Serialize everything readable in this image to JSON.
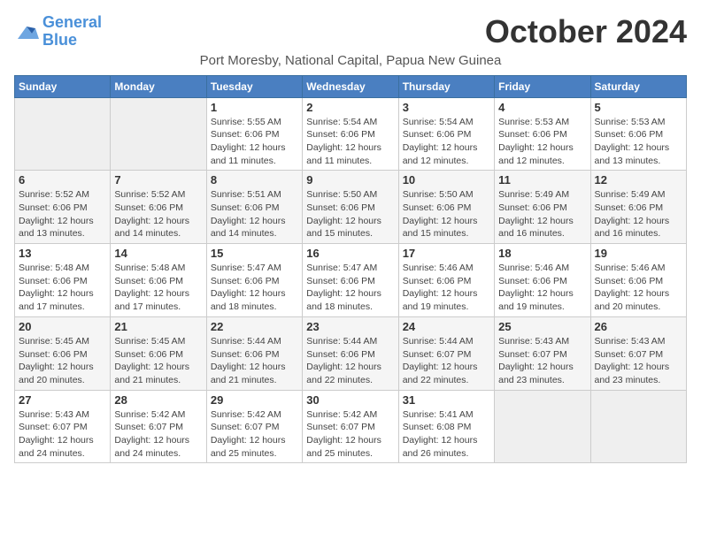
{
  "logo": {
    "line1": "General",
    "line2": "Blue"
  },
  "title": "October 2024",
  "subtitle": "Port Moresby, National Capital, Papua New Guinea",
  "weekdays": [
    "Sunday",
    "Monday",
    "Tuesday",
    "Wednesday",
    "Thursday",
    "Friday",
    "Saturday"
  ],
  "weeks": [
    [
      {
        "day": "",
        "info": ""
      },
      {
        "day": "",
        "info": ""
      },
      {
        "day": "1",
        "info": "Sunrise: 5:55 AM\nSunset: 6:06 PM\nDaylight: 12 hours and 11 minutes."
      },
      {
        "day": "2",
        "info": "Sunrise: 5:54 AM\nSunset: 6:06 PM\nDaylight: 12 hours and 11 minutes."
      },
      {
        "day": "3",
        "info": "Sunrise: 5:54 AM\nSunset: 6:06 PM\nDaylight: 12 hours and 12 minutes."
      },
      {
        "day": "4",
        "info": "Sunrise: 5:53 AM\nSunset: 6:06 PM\nDaylight: 12 hours and 12 minutes."
      },
      {
        "day": "5",
        "info": "Sunrise: 5:53 AM\nSunset: 6:06 PM\nDaylight: 12 hours and 13 minutes."
      }
    ],
    [
      {
        "day": "6",
        "info": "Sunrise: 5:52 AM\nSunset: 6:06 PM\nDaylight: 12 hours and 13 minutes."
      },
      {
        "day": "7",
        "info": "Sunrise: 5:52 AM\nSunset: 6:06 PM\nDaylight: 12 hours and 14 minutes."
      },
      {
        "day": "8",
        "info": "Sunrise: 5:51 AM\nSunset: 6:06 PM\nDaylight: 12 hours and 14 minutes."
      },
      {
        "day": "9",
        "info": "Sunrise: 5:50 AM\nSunset: 6:06 PM\nDaylight: 12 hours and 15 minutes."
      },
      {
        "day": "10",
        "info": "Sunrise: 5:50 AM\nSunset: 6:06 PM\nDaylight: 12 hours and 15 minutes."
      },
      {
        "day": "11",
        "info": "Sunrise: 5:49 AM\nSunset: 6:06 PM\nDaylight: 12 hours and 16 minutes."
      },
      {
        "day": "12",
        "info": "Sunrise: 5:49 AM\nSunset: 6:06 PM\nDaylight: 12 hours and 16 minutes."
      }
    ],
    [
      {
        "day": "13",
        "info": "Sunrise: 5:48 AM\nSunset: 6:06 PM\nDaylight: 12 hours and 17 minutes."
      },
      {
        "day": "14",
        "info": "Sunrise: 5:48 AM\nSunset: 6:06 PM\nDaylight: 12 hours and 17 minutes."
      },
      {
        "day": "15",
        "info": "Sunrise: 5:47 AM\nSunset: 6:06 PM\nDaylight: 12 hours and 18 minutes."
      },
      {
        "day": "16",
        "info": "Sunrise: 5:47 AM\nSunset: 6:06 PM\nDaylight: 12 hours and 18 minutes."
      },
      {
        "day": "17",
        "info": "Sunrise: 5:46 AM\nSunset: 6:06 PM\nDaylight: 12 hours and 19 minutes."
      },
      {
        "day": "18",
        "info": "Sunrise: 5:46 AM\nSunset: 6:06 PM\nDaylight: 12 hours and 19 minutes."
      },
      {
        "day": "19",
        "info": "Sunrise: 5:46 AM\nSunset: 6:06 PM\nDaylight: 12 hours and 20 minutes."
      }
    ],
    [
      {
        "day": "20",
        "info": "Sunrise: 5:45 AM\nSunset: 6:06 PM\nDaylight: 12 hours and 20 minutes."
      },
      {
        "day": "21",
        "info": "Sunrise: 5:45 AM\nSunset: 6:06 PM\nDaylight: 12 hours and 21 minutes."
      },
      {
        "day": "22",
        "info": "Sunrise: 5:44 AM\nSunset: 6:06 PM\nDaylight: 12 hours and 21 minutes."
      },
      {
        "day": "23",
        "info": "Sunrise: 5:44 AM\nSunset: 6:06 PM\nDaylight: 12 hours and 22 minutes."
      },
      {
        "day": "24",
        "info": "Sunrise: 5:44 AM\nSunset: 6:07 PM\nDaylight: 12 hours and 22 minutes."
      },
      {
        "day": "25",
        "info": "Sunrise: 5:43 AM\nSunset: 6:07 PM\nDaylight: 12 hours and 23 minutes."
      },
      {
        "day": "26",
        "info": "Sunrise: 5:43 AM\nSunset: 6:07 PM\nDaylight: 12 hours and 23 minutes."
      }
    ],
    [
      {
        "day": "27",
        "info": "Sunrise: 5:43 AM\nSunset: 6:07 PM\nDaylight: 12 hours and 24 minutes."
      },
      {
        "day": "28",
        "info": "Sunrise: 5:42 AM\nSunset: 6:07 PM\nDaylight: 12 hours and 24 minutes."
      },
      {
        "day": "29",
        "info": "Sunrise: 5:42 AM\nSunset: 6:07 PM\nDaylight: 12 hours and 25 minutes."
      },
      {
        "day": "30",
        "info": "Sunrise: 5:42 AM\nSunset: 6:07 PM\nDaylight: 12 hours and 25 minutes."
      },
      {
        "day": "31",
        "info": "Sunrise: 5:41 AM\nSunset: 6:08 PM\nDaylight: 12 hours and 26 minutes."
      },
      {
        "day": "",
        "info": ""
      },
      {
        "day": "",
        "info": ""
      }
    ]
  ]
}
